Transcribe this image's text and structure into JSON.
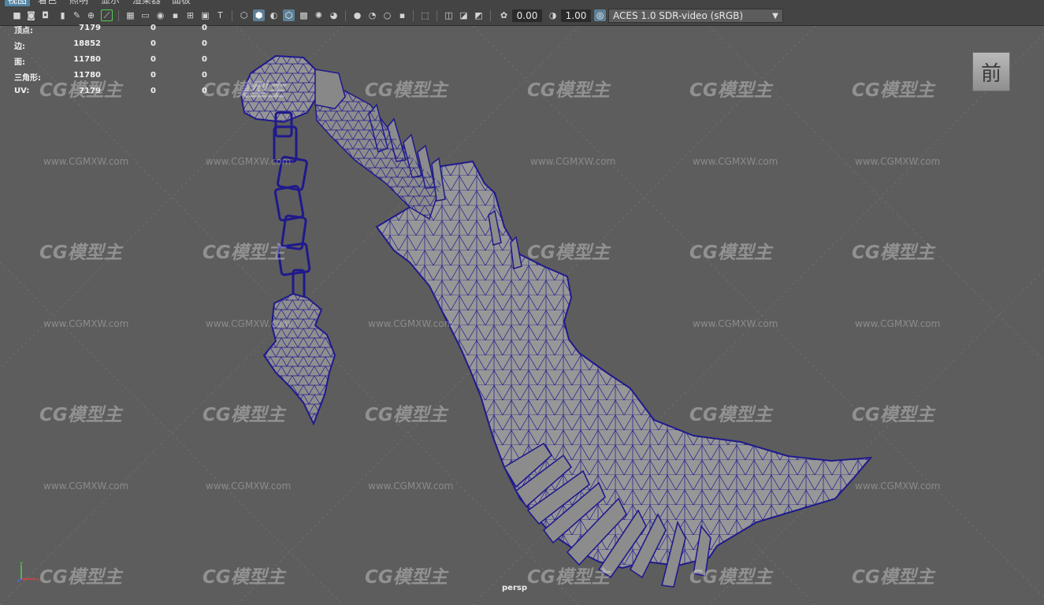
{
  "menu": {
    "items": [
      "视图",
      "着色",
      "照明",
      "显示",
      "渲染器",
      "面板"
    ]
  },
  "toolbar": {
    "exposure_value": "0.00",
    "gamma_value": "1.00",
    "color_management": "ACES 1.0 SDR-video (sRGB)",
    "icons": [
      "camera-icon",
      "camera-attributes-icon",
      "bookmark-icon",
      "grease-pencil-icon",
      "image-plane-icon",
      "2d-pan-zoom-icon",
      "grid-icon",
      "film-gate-icon",
      "resolution-gate-icon",
      "gate-mask-icon",
      "field-chart-icon",
      "safe-action-icon",
      "safe-title-icon",
      "wireframe-icon",
      "smooth-shade-icon",
      "default-material-icon",
      "wireframe-on-shaded-icon",
      "textured-icon",
      "use-all-lights-icon",
      "shadows-icon",
      "screen-space-ao-icon",
      "motion-blur-icon",
      "anti-aliasing-icon",
      "depth-of-field-icon",
      "isolate-select-icon",
      "xray-icon",
      "xray-joints-icon",
      "backface-culling-icon",
      "exposure-icon",
      "gamma-icon",
      "color-management-icon"
    ],
    "accent": "#5285a6",
    "highlight": "#5d7f96"
  },
  "hud": {
    "rows": [
      {
        "label": "顶点:",
        "v1": "7179",
        "v2": "0",
        "v3": "0"
      },
      {
        "label": "边:",
        "v1": "18852",
        "v2": "0",
        "v3": "0"
      },
      {
        "label": "面:",
        "v1": "11780",
        "v2": "0",
        "v3": "0"
      },
      {
        "label": "三角形:",
        "v1": "11780",
        "v2": "0",
        "v3": "0"
      },
      {
        "label": "UV:",
        "v1": "7179",
        "v2": "0",
        "v3": "0"
      }
    ]
  },
  "viewcube": {
    "label": "前"
  },
  "camera": {
    "name": "persp"
  },
  "axis": {
    "y": "y",
    "x": "x"
  },
  "watermark": {
    "logo": "CG模型主",
    "url": "www.CGMXW.com"
  },
  "colors": {
    "viewport_bg": "#5d5d5d",
    "wireframe": "#1f1a8c",
    "mesh_fill": "#9a9a9a"
  }
}
